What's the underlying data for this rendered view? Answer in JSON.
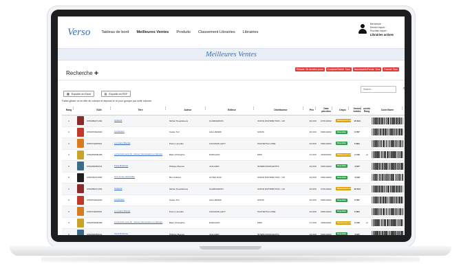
{
  "nav": {
    "logo": "Verso",
    "items": [
      {
        "label": "Tableau de bord",
        "active": false
      },
      {
        "label": "Meilleures Ventes",
        "active": true
      },
      {
        "label": "Produits",
        "active": false
      },
      {
        "label": "Classement Librairies",
        "active": false
      },
      {
        "label": "Librairies",
        "active": false
      }
    ]
  },
  "user": {
    "line1": "Bienvenue",
    "line2": "Dernier import :",
    "line3": "Prochain import :",
    "libraries": "Librairies actives"
  },
  "banner": {
    "title": "Meilleures Ventes"
  },
  "search": {
    "title": "Recherche",
    "plus": "+",
    "filters": [
      "Période: 26 derniers jours",
      "Comptoir/Distrib: Tous",
      "Nouveautés/Fonds: Tous",
      "Format: Tous"
    ]
  },
  "toolbar": {
    "excel_label": "Exporter en Excel",
    "pdf_label": "Exporter en PDF",
    "search_placeholder": "Search..."
  },
  "grid": {
    "drag_hint": "Faites glisser un en-tête de colonne et déposer-le ici pour grouper par cette colonne.",
    "headers": {
      "rang": "Rang",
      "ean": "EAN",
      "titre": "Titre",
      "auteur": "Auteur",
      "editeur": "Editeur",
      "distributeur": "Distributeur",
      "prix": "Prix",
      "date": "Date parution",
      "dispo": "Dispo",
      "ventes": "Ventes totales",
      "evol": "Evolution Rang",
      "barcode": "Code Barre"
    },
    "rows": [
      {
        "rang": "1",
        "cover": "#8a2a2a",
        "ean": "9782080271302",
        "titre": "Anéantir",
        "auteur": "Michel Houellebecq",
        "editeur": "FLAMMARION",
        "distrib": "UNION DISTRIBUTION - UD",
        "prix": "26,00 €",
        "date": "07/01/2022",
        "dispo": "Réimpression en cours",
        "dispo_color": "#e0a100",
        "ventes": "15 644",
        "evol": ""
      },
      {
        "rang": "2",
        "cover": "#c0392b",
        "ean": "9782072942640",
        "titre": "La divinion",
        "auteur": "Karine Tuil",
        "editeur": "GALLIMARD",
        "distrib": "SODIS",
        "prix": "20,00 €",
        "date": "06/01/2022",
        "dispo": "Disponible",
        "dispo_color": "#2e9e47",
        "ventes": "6 787",
        "evol": ""
      },
      {
        "rang": "3",
        "cover": "#d87a1e",
        "ean": "9782701165913",
        "titre": "Le Grand Mande",
        "auteur": "Pierre Lemaitre",
        "editeur": "CALMANN-LEVY",
        "distrib": "HACHETTE LIVRE",
        "prix": "22,90 €",
        "date": "05/01/2022",
        "dispo": "Disponible",
        "dispo_color": "#2e9e47",
        "ventes": "5 691",
        "evol": ""
      },
      {
        "rang": "4",
        "cover": "#c9a227",
        "ean": "9782253008168",
        "titre": "La Société sans fin: refuser l'atomisation et détruire",
        "auteur": "Blain Christophe",
        "editeur": "DARGAUD",
        "distrib": "MDS",
        "prix": "27,00 €",
        "date": "29/10/2021",
        "dispo": "Réimpression en cours",
        "dispo_color": "#e0a100",
        "ventes": "2 416",
        "evol": "+4"
      },
      {
        "rang": "5",
        "cover": "#3d6b8a",
        "ean": "9782260054241",
        "titre": "Paris-Brisbane",
        "auteur": "Philippe Besson",
        "editeur": "JULLIARD",
        "distrib": "INTERFORUM EDITIS",
        "prix": "19,00 €",
        "date": "06/01/2022",
        "dispo": "Disponible",
        "dispo_color": "#2e9e47",
        "ventes": "4 527",
        "evol": ""
      },
      {
        "rang": "6",
        "cover": "#1f1f1f",
        "ean": "9782330157652",
        "titre": "Une année fascinable",
        "auteur": "Ben Volkard",
        "editeur": "ACTES SUD",
        "distrib": "UNION DISTRIBUTION - UD",
        "prix": "19,00 €",
        "date": "05/01/2022",
        "dispo": "Disponible",
        "dispo_color": "#2e9e47",
        "ventes": "4 319",
        "evol": ""
      },
      {
        "rang": "1",
        "cover": "#8a2a2a",
        "ean": "9782080271302",
        "titre": "Anéantir",
        "auteur": "Michel Houellebecq",
        "editeur": "FLAMMARION",
        "distrib": "UNION DISTRIBUTION - UD",
        "prix": "26,00 €",
        "date": "07/01/2022",
        "dispo": "Réimpression en cours",
        "dispo_color": "#e0a100",
        "ventes": "15 644",
        "evol": ""
      },
      {
        "rang": "2",
        "cover": "#c0392b",
        "ean": "9782072942640",
        "titre": "La divinion",
        "auteur": "Karine Tuil",
        "editeur": "GALLIMARD",
        "distrib": "SODIS",
        "prix": "20,00 €",
        "date": "06/01/2022",
        "dispo": "Disponible",
        "dispo_color": "#2e9e47",
        "ventes": "6 787",
        "evol": ""
      },
      {
        "rang": "3",
        "cover": "#d87a1e",
        "ean": "9782701165913",
        "titre": "Le Grand Mande",
        "auteur": "Pierre Lemaitre",
        "editeur": "CALMANN-LEVY",
        "distrib": "HACHETTE LIVRE",
        "prix": "22,90 €",
        "date": "05/01/2022",
        "dispo": "Disponible",
        "dispo_color": "#2e9e47",
        "ventes": "5 691",
        "evol": ""
      },
      {
        "rang": "4",
        "cover": "#c9a227",
        "ean": "9782253008168",
        "titre": "La Société sans fin: refuser l'atomisation et détruire",
        "auteur": "Blain Christophe",
        "editeur": "DARGAUD",
        "distrib": "MDS",
        "prix": "27,00 €",
        "date": "29/10/2021",
        "dispo": "Réimpression en cours",
        "dispo_color": "#e0a100",
        "ventes": "2 416",
        "evol": "+4"
      },
      {
        "rang": "5",
        "cover": "#3d6b8a",
        "ean": "9782260054241",
        "titre": "Paris-Brisbane",
        "auteur": "Philippe Besson",
        "editeur": "JULLIARD",
        "distrib": "INTERFORUM EDITIS",
        "prix": "19,00 €",
        "date": "06/01/2022",
        "dispo": "Disponible",
        "dispo_color": "#2e9e47",
        "ventes": "4 527",
        "evol": ""
      }
    ]
  }
}
